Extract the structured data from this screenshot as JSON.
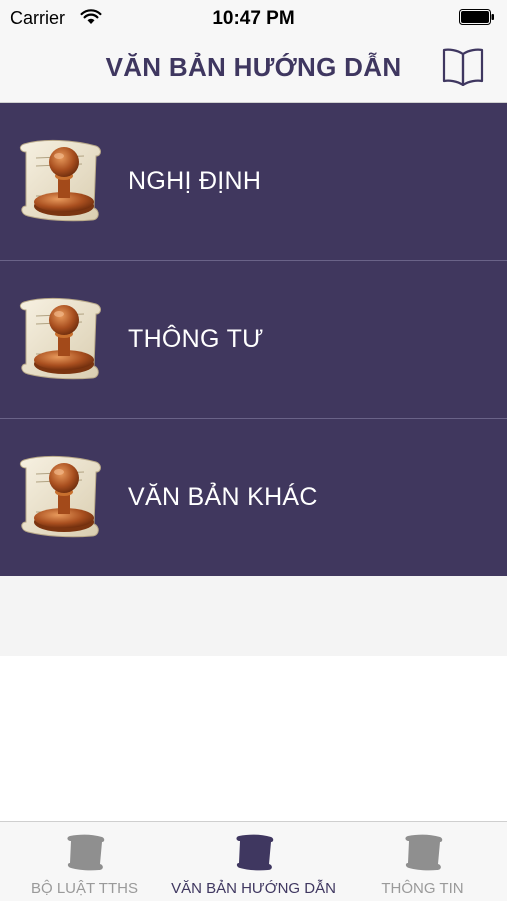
{
  "status_bar": {
    "carrier": "Carrier",
    "time": "10:47 PM"
  },
  "header": {
    "title": "VĂN BẢN HƯỚNG DẪN",
    "right_icon": "book-icon"
  },
  "list": {
    "items": [
      {
        "label": "NGHỊ ĐỊNH",
        "icon": "stamp-scroll-icon"
      },
      {
        "label": "THÔNG TƯ",
        "icon": "stamp-scroll-icon"
      },
      {
        "label": "VĂN BẢN KHÁC",
        "icon": "stamp-scroll-icon"
      }
    ]
  },
  "tab_bar": {
    "tabs": [
      {
        "label": "BỘ LUẬT TTHS",
        "icon": "scroll-icon",
        "active": false
      },
      {
        "label": "VĂN BẢN HƯỚNG DẪN",
        "icon": "scroll-icon",
        "active": true
      },
      {
        "label": "THÔNG TIN",
        "icon": "scroll-icon",
        "active": false
      }
    ]
  },
  "colors": {
    "accent": "#3f3760",
    "list_background": "#40375e",
    "inactive_tab": "#9a9a9a"
  }
}
